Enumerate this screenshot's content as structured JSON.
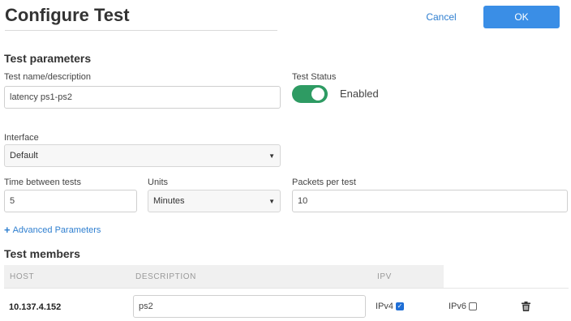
{
  "header": {
    "title": "Configure Test",
    "cancel_label": "Cancel",
    "ok_label": "OK"
  },
  "params": {
    "section_title": "Test parameters",
    "name_label": "Test name/description",
    "name_value": "latency ps1-ps2",
    "status_label": "Test Status",
    "status_enabled": true,
    "status_text": "Enabled",
    "interface_label": "Interface",
    "interface_value": "Default",
    "time_label": "Time between tests",
    "time_value": "5",
    "units_label": "Units",
    "units_value": "Minutes",
    "packets_label": "Packets per test",
    "packets_value": "10",
    "advanced_label": "Advanced Parameters"
  },
  "members": {
    "section_title": "Test members",
    "columns": [
      "HOST",
      "DESCRIPTION",
      "IPV"
    ],
    "rows": [
      {
        "host": "10.137.4.152",
        "description": "ps2",
        "ipv4_label": "IPv4",
        "ipv4_checked": true,
        "ipv6_label": "IPv6",
        "ipv6_checked": false
      }
    ]
  },
  "colors": {
    "accent": "#3a8ee6",
    "link": "#2f7fd0",
    "toggle_on": "#2e9b63"
  },
  "icons": [
    "caret-down-icon",
    "plus-icon",
    "checkbox-icon",
    "trash-icon"
  ]
}
